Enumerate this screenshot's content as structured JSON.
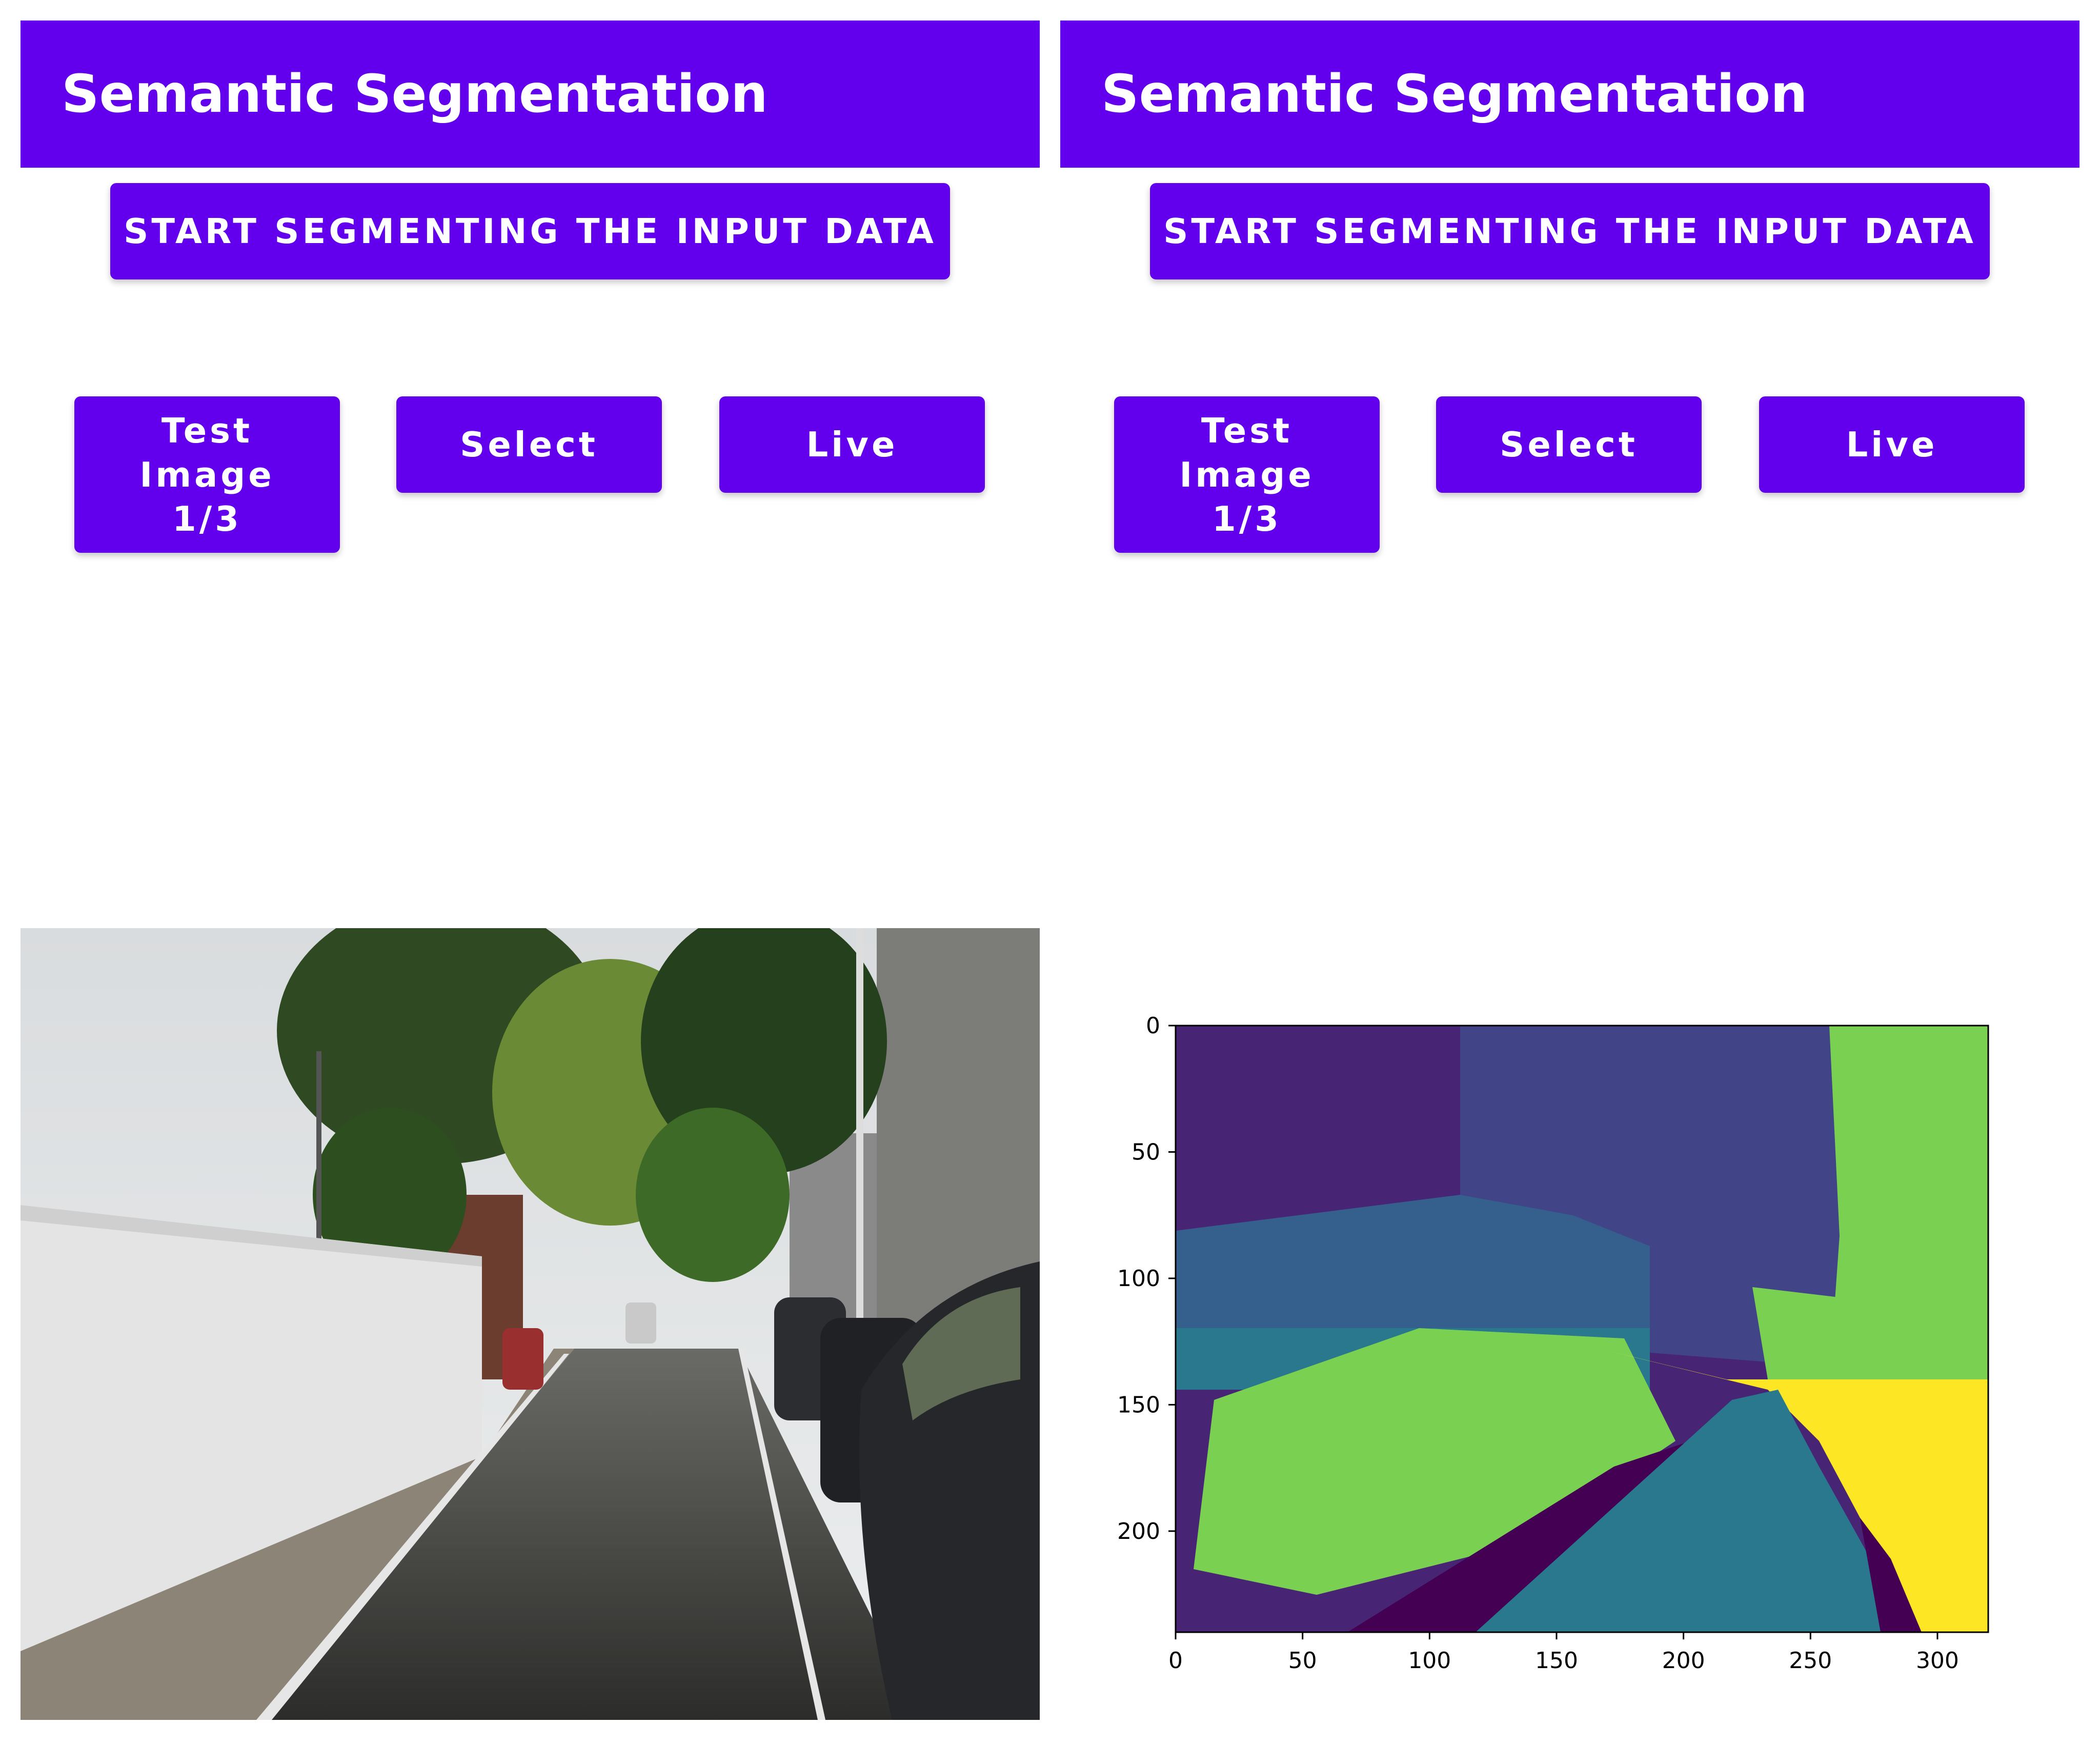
{
  "left": {
    "title": "Semantic Segmentation",
    "start_button": "START SEGMENTING THE INPUT DATA",
    "test_button": [
      "Test",
      "Image",
      "1/3"
    ],
    "select_button": "Select",
    "live_button": "Live"
  },
  "right": {
    "title": "Semantic Segmentation",
    "start_button": "START SEGMENTING THE INPUT DATA",
    "test_button": [
      "Test",
      "Image",
      "1/3"
    ],
    "select_button": "Select",
    "live_button": "Live"
  },
  "theme": {
    "primary": "#6200ee",
    "on_primary": "#ffffff"
  },
  "segmentation_plot": {
    "x_ticks": [
      "0",
      "50",
      "100",
      "150",
      "200",
      "250",
      "300"
    ],
    "y_ticks": [
      "0",
      "50",
      "100",
      "150",
      "200"
    ],
    "x_range": [
      0,
      320
    ],
    "y_range": [
      0,
      240
    ],
    "colormap": [
      "#440154",
      "#482475",
      "#414487",
      "#355f8d",
      "#2a788e",
      "#21918c",
      "#7ad151",
      "#b5de2b",
      "#fde725"
    ]
  }
}
